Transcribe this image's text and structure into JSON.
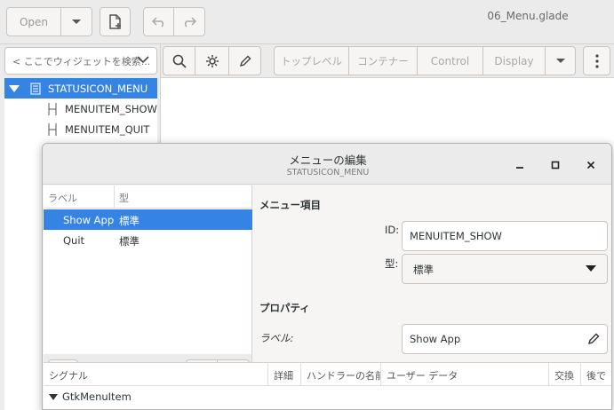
{
  "header": {
    "open_label": "Open",
    "file_name": "06_Menu.glade"
  },
  "toolbar": {
    "search_placeholder": "< ここでウィジェットを検索...",
    "tabs": [
      "トップレベル",
      "コンテナー",
      "Control",
      "Display"
    ]
  },
  "tree": {
    "items": [
      {
        "label": "STATUSICON_MENU"
      },
      {
        "label": "MENUITEM_SHOW"
      },
      {
        "label": "MENUITEM_QUIT"
      }
    ]
  },
  "dialog": {
    "title": "メニューの編集",
    "subtitle": "STATUSICON_MENU",
    "list": {
      "col_label": "ラベル",
      "col_type": "型",
      "rows": [
        {
          "label": "Show App",
          "type": "標準"
        },
        {
          "label": "Quit",
          "type": "標準"
        }
      ]
    },
    "props": {
      "menu_item_header": "メニュー項目",
      "id_label": "ID:",
      "id_value": "MENUITEM_SHOW",
      "type_label": "型:",
      "type_value": "標準",
      "properties_header": "プロパティ",
      "label_label": "ラベル:",
      "label_value": "Show App"
    },
    "signals": {
      "columns": [
        "シグナル",
        "詳細",
        "ハンドラーの名前",
        "ユーザー データ",
        "交換",
        "後で"
      ],
      "group": "GtkMenuItem"
    }
  },
  "colors": {
    "accent": "#3584e4",
    "window_bg": "#f6f5f4",
    "header_bg": "#ebebeb"
  }
}
